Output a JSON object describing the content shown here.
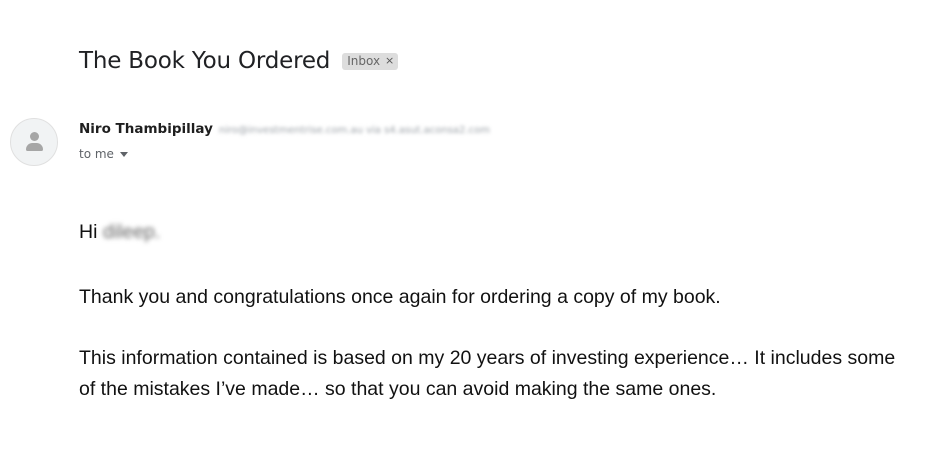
{
  "email": {
    "subject": "The Book You Ordered",
    "label": "Inbox",
    "label_remove_icon": "×",
    "sender": {
      "name": "Niro Thambipillay",
      "email": "niro@investmentrise.com.au via s4.asut.aconsa2.com"
    },
    "recipient": "to me",
    "body": {
      "greeting_prefix": "Hi",
      "greeting_name": "dileep.",
      "paragraph1": "Thank you and congratulations once again for ordering a copy of my book.",
      "paragraph2": "This information contained is based on my 20 years of investing experience… It includes some of the mistakes I’ve made… so that you can avoid making the same ones."
    }
  },
  "icons": {
    "avatar": "default-person-avatar-icon",
    "recipient_dropdown": "caret-down-icon",
    "label_remove": "close-icon"
  }
}
